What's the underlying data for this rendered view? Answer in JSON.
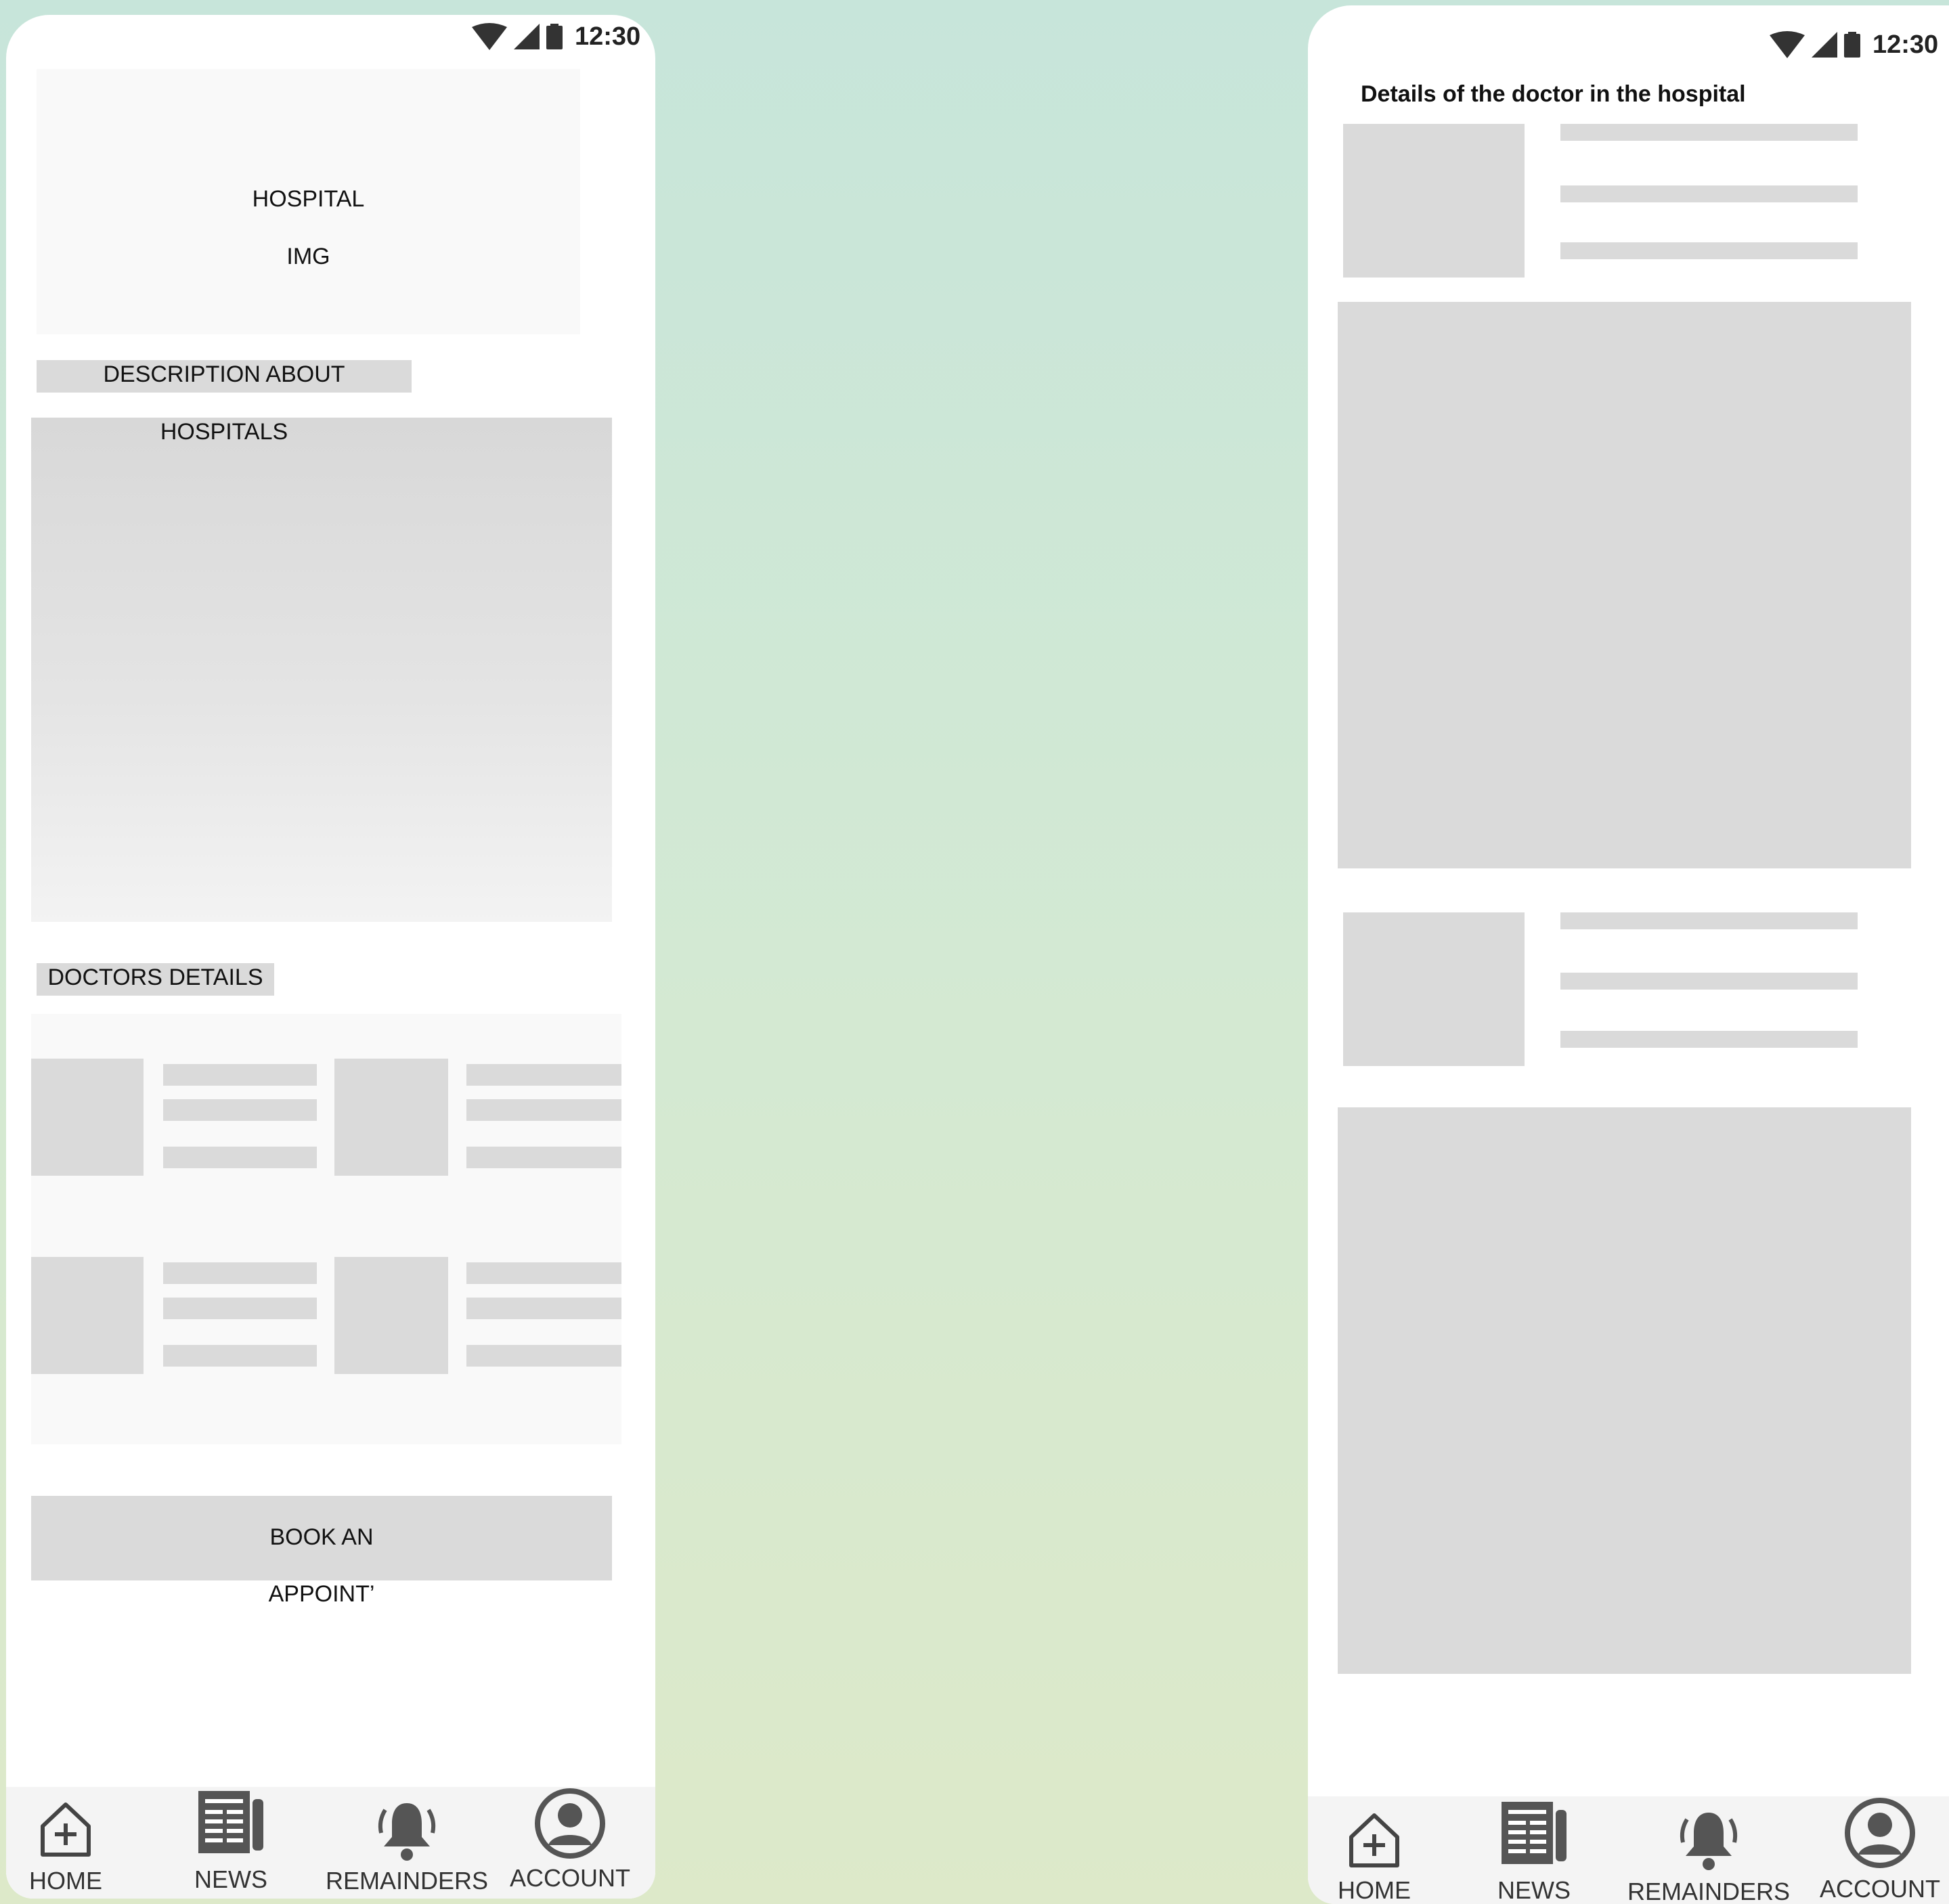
{
  "status_bar": {
    "time": "12:30"
  },
  "left_screen": {
    "hospital_image": {
      "line1": "HOSPITAL",
      "line2": "IMG"
    },
    "description": {
      "label_line1": "DESCRIPTION ABOUT",
      "label_line2": "HOSPITALS"
    },
    "doctors": {
      "label": "DOCTORS  DETAILS"
    },
    "book_button": {
      "line1": "BOOK AN",
      "line2": "APPOINT’"
    }
  },
  "right_screen": {
    "title": "Details of the doctor in the hospital"
  },
  "nav": {
    "items": [
      {
        "label": "HOME",
        "icon": "home-plus-icon"
      },
      {
        "label": "NEWS",
        "icon": "newspaper-icon"
      },
      {
        "label": "REMAINDERS",
        "icon": "bell-icon"
      },
      {
        "label": "ACCOUNT",
        "icon": "account-icon"
      }
    ]
  },
  "colors": {
    "placeholder_gray": "#dadada",
    "placeholder_light": "#f9f9f9",
    "background_top": "#c7e5da",
    "background_bottom": "#dde9c9"
  }
}
